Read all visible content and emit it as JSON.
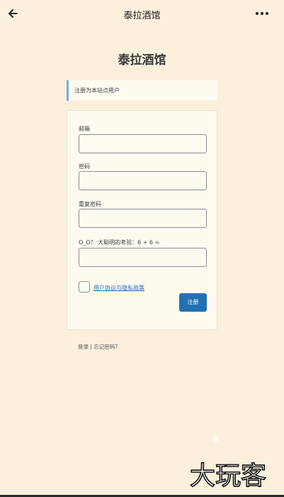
{
  "header": {
    "title": "泰拉酒馆"
  },
  "site": {
    "title": "泰拉酒馆"
  },
  "notice": {
    "text": "注册为本站点用户"
  },
  "form": {
    "email_label": "邮箱",
    "password_label": "密码",
    "repeat_password_label": "重复密码",
    "captcha_label": "O_O？ 大聪明的考验：6 + 6 =",
    "agreement_link": "用户协议与隐私政策",
    "submit_label": "注册"
  },
  "footer": {
    "login_link": "登录",
    "separator": "|",
    "forgot_link": "忘记密码?"
  },
  "watermark": {
    "text": "大玩客"
  },
  "colors": {
    "background": "#faf0dc",
    "accent": "#2271b1",
    "notice_border": "#72aee6"
  }
}
